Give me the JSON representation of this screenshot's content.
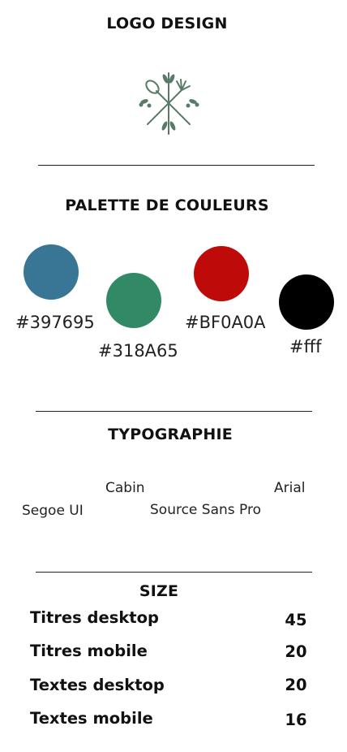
{
  "logo": {
    "heading": "LOGO DESIGN",
    "icon": "crossed-spoon-fork-olive-branch-icon",
    "color": "#5a7a68"
  },
  "palette": {
    "heading": "PALETTE DE COULEURS",
    "colors": [
      {
        "label": "#397695",
        "hex": "#397695"
      },
      {
        "label": "#318A65",
        "hex": "#318A65"
      },
      {
        "label": "#BF0A0A",
        "hex": "#BF0A0A"
      },
      {
        "label": "#fff",
        "hex": "#000000"
      }
    ]
  },
  "typography": {
    "heading": "TYPOGRAPHIE",
    "fonts": [
      "Cabin",
      "Arial",
      "Segoe UI",
      "Source Sans Pro"
    ]
  },
  "size": {
    "heading": "SIZE",
    "rows": [
      {
        "label": "Titres desktop",
        "value": "45"
      },
      {
        "label": "Titres mobile",
        "value": "20"
      },
      {
        "label": "Textes desktop",
        "value": "20"
      },
      {
        "label": "Textes mobile",
        "value": "16"
      }
    ]
  }
}
